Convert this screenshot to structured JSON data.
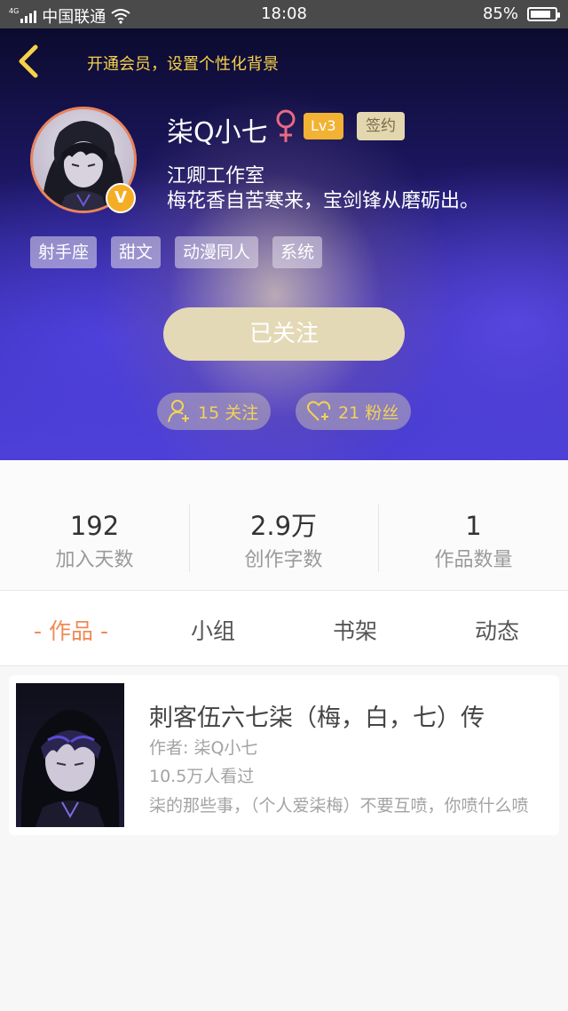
{
  "status_bar": {
    "network": "4G",
    "carrier": "中国联通",
    "time": "18:08",
    "battery": "85%",
    "battery_level": 0.85
  },
  "header": {
    "back_icon": "chevron-left-icon",
    "vip_banner": "开通会员，设置个性化背景",
    "avatar_badge": "V",
    "username": "柒Q小七",
    "gender_icon": "female-icon",
    "level": "Lv3",
    "sign_badge": "签约",
    "studio": "江卿工作室",
    "motto": "梅花香自苦寒来，宝剑锋从磨砺出。",
    "tags": [
      "射手座",
      "甜文",
      "动漫同人",
      "系统"
    ],
    "follow_button": "已关注",
    "follows": "15 关注",
    "fans": "21 粉丝",
    "colors": {
      "accent_gold": "#f6d249",
      "follow_button_bg": "#e4d9b6",
      "level_badge": "#f2b233"
    }
  },
  "stats": [
    {
      "value": "192",
      "label": "加入天数"
    },
    {
      "value": "2.9万",
      "label": "创作字数"
    },
    {
      "value": "1",
      "label": "作品数量"
    }
  ],
  "tabs": [
    {
      "label": "- 作品 -",
      "active": true
    },
    {
      "label": "小组",
      "active": false
    },
    {
      "label": "书架",
      "active": false
    },
    {
      "label": "动态",
      "active": false
    }
  ],
  "works": [
    {
      "title": "刺客伍六七柒（梅，白，七）传",
      "author": "作者: 柒Q小七",
      "views": "10.5万人看过",
      "description": "柒的那些事，（个人爱柒梅）不要互喷，你喷什么喷"
    }
  ],
  "colors": {
    "tab_active": "#ef8a55"
  }
}
